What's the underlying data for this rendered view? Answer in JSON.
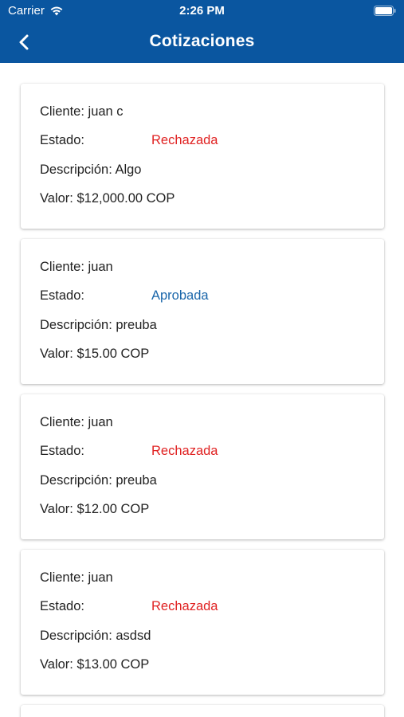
{
  "status_bar": {
    "carrier": "Carrier",
    "time": "2:26 PM"
  },
  "header": {
    "title": "Cotizaciones",
    "back_icon": "chevron-left-icon"
  },
  "colors": {
    "header_bg": "#0a56a0",
    "rejected": "#e02222",
    "approved": "#1a66aa"
  },
  "quotes": [
    {
      "cliente": "Cliente: juan c",
      "estado_label": "Estado:",
      "estado": "Rechazada",
      "estado_color": "#e02222",
      "descripcion": "Descripción: Algo",
      "valor": "Valor: $12,000.00 COP"
    },
    {
      "cliente": "Cliente: juan",
      "estado_label": "Estado:",
      "estado": "Aprobada",
      "estado_color": "#1a66aa",
      "descripcion": "Descripción: preuba",
      "valor": "Valor: $15.00 COP"
    },
    {
      "cliente": "Cliente: juan",
      "estado_label": "Estado:",
      "estado": "Rechazada",
      "estado_color": "#e02222",
      "descripcion": "Descripción: preuba",
      "valor": "Valor: $12.00 COP"
    },
    {
      "cliente": "Cliente: juan",
      "estado_label": "Estado:",
      "estado": "Rechazada",
      "estado_color": "#e02222",
      "descripcion": "Descripción: asdsd",
      "valor": "Valor: $13.00 COP"
    }
  ]
}
